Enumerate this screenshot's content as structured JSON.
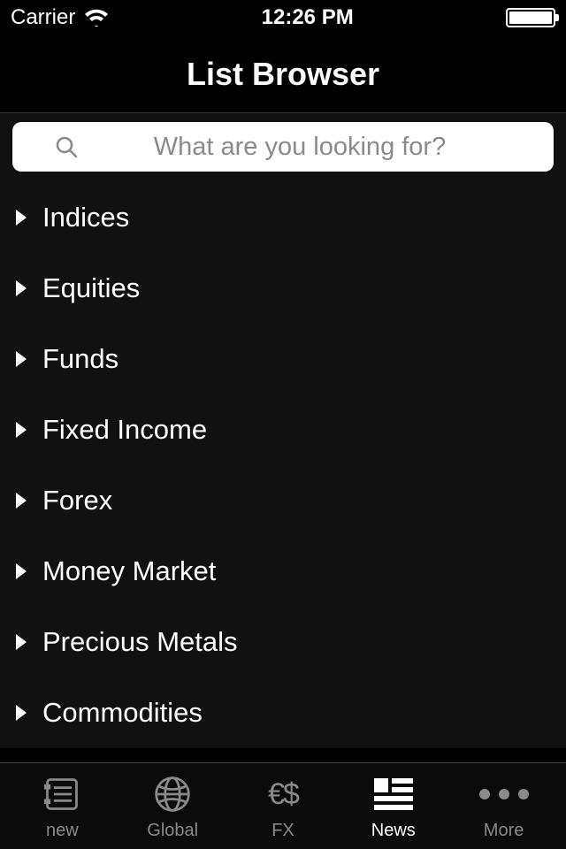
{
  "statusbar": {
    "carrier": "Carrier",
    "time": "12:26 PM"
  },
  "header": {
    "title": "List Browser"
  },
  "search": {
    "placeholder": "What are you looking for?"
  },
  "categories": [
    {
      "label": "Indices"
    },
    {
      "label": "Equities"
    },
    {
      "label": "Funds"
    },
    {
      "label": "Fixed Income"
    },
    {
      "label": "Forex"
    },
    {
      "label": "Money Market"
    },
    {
      "label": "Precious Metals"
    },
    {
      "label": "Commodities"
    }
  ],
  "tabs": [
    {
      "label": "new"
    },
    {
      "label": "Global"
    },
    {
      "label": "FX"
    },
    {
      "label": "News"
    },
    {
      "label": "More"
    }
  ]
}
